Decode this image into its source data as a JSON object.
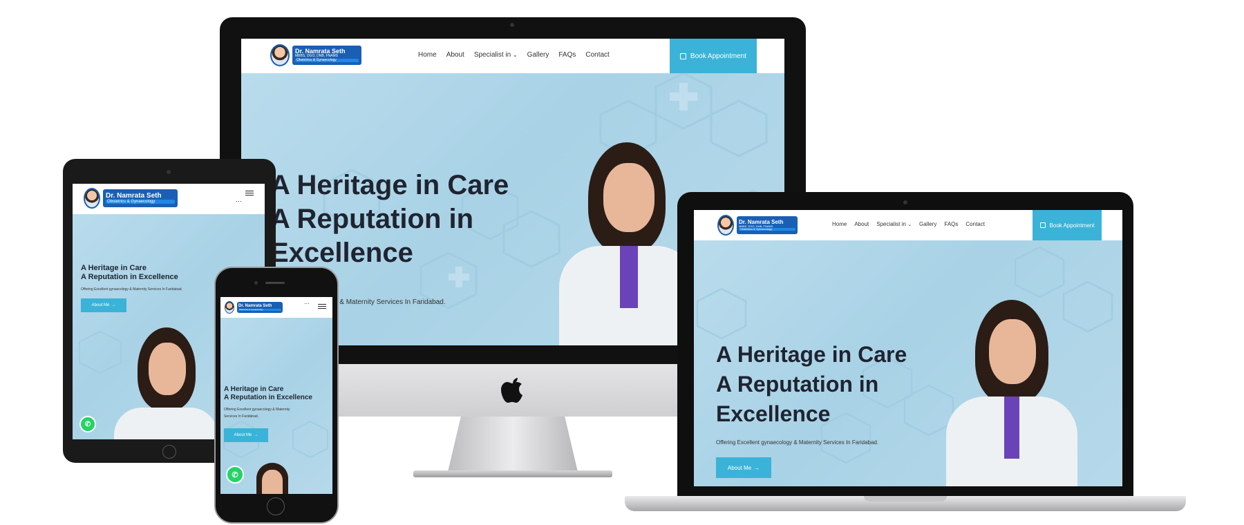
{
  "brand": {
    "name": "Dr. Namrata Seth",
    "credentials": "MBBS, DGO, DNB, FNAMS",
    "specialty": "Obstetrics & Gynaecology"
  },
  "nav": {
    "items": [
      "Home",
      "About",
      "Specialist in",
      "Gallery",
      "FAQs",
      "Contact"
    ],
    "dropdown_indicator": "⌄",
    "book_label": "Book Appointment",
    "more_dots": "···"
  },
  "hero": {
    "line1": "A Heritage in Care",
    "line2": "A Reputation in",
    "line3": "Excellence",
    "line2_full": "A Reputation in Excellence",
    "subtitle": "Offering Excellent gynaecology & Maternity Services In Faridabad.",
    "subtitle_partial": "ecology & Maternity Services In Faridabad.",
    "mobile_sub1": "Offering Excellent gynaecology & Maternity",
    "mobile_sub2": "Services In Faridabad.",
    "about_label": "About Me",
    "arrow": "→"
  },
  "colors": {
    "accent": "#3bb3d8",
    "brand_blue": "#1a5fb4",
    "hero_bg": "#b0d6e9",
    "whatsapp": "#25d366"
  },
  "icons": {
    "apple": "apple-logo-icon",
    "calendar": "calendar-icon",
    "whatsapp": "whatsapp-icon",
    "menu": "hamburger-menu-icon"
  }
}
